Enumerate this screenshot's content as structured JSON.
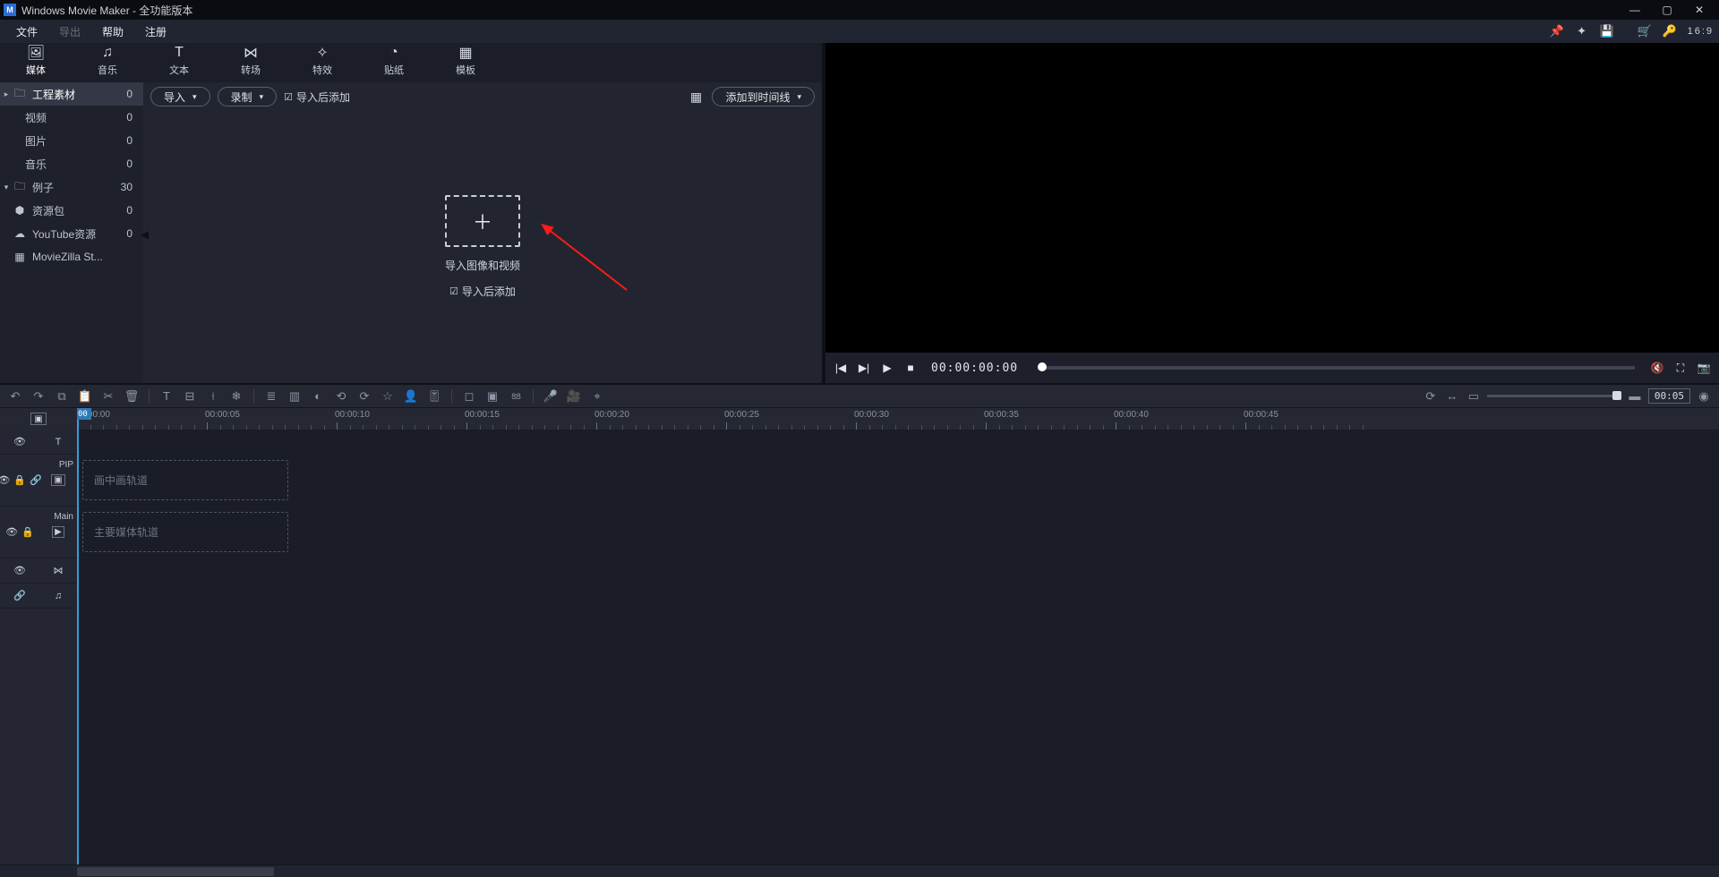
{
  "window": {
    "logo_text": "M",
    "title": "Windows Movie Maker  - 全功能版本"
  },
  "menu": {
    "file": "文件",
    "export": "导出",
    "help": "帮助",
    "register": "注册",
    "aspect_ratio": "16:9"
  },
  "tabs": {
    "media": "媒体",
    "music": "音乐",
    "text": "文本",
    "transition": "转场",
    "effects": "特效",
    "stickers": "贴纸",
    "templates": "模板"
  },
  "sidebar": {
    "project_media": {
      "label": "工程素材",
      "count": "0"
    },
    "video": {
      "label": "视频",
      "count": "0"
    },
    "image": {
      "label": "图片",
      "count": "0"
    },
    "music": {
      "label": "音乐",
      "count": "0"
    },
    "examples": {
      "label": "例子",
      "count": "30"
    },
    "asset_pack": {
      "label": "资源包",
      "count": "0"
    },
    "youtube": {
      "label": "YouTube资源",
      "count": "0"
    },
    "moviezilla": {
      "label": "MovieZilla St..."
    }
  },
  "library_toolbar": {
    "import": "导入",
    "record": "录制",
    "add_after_import": "导入后添加",
    "add_to_timeline": "添加到时间线"
  },
  "drop_area": {
    "line1": "导入图像和视频",
    "line2": "导入后添加"
  },
  "preview": {
    "timecode": "00:00:00:00"
  },
  "timeline": {
    "zoom_value": "00:05",
    "playhead_label": "0:00",
    "time_marks": [
      "00:00:00",
      "00:00:05",
      "00:00:10",
      "00:00:15",
      "00:00:20",
      "00:00:25",
      "00:00:30",
      "00:00:35",
      "00:00:40",
      "00:00:45"
    ],
    "track_pip_short": "PIP",
    "track_pip_slot": "画中画轨道",
    "track_main_short": "Main",
    "track_main_slot": "主要媒体轨道"
  }
}
